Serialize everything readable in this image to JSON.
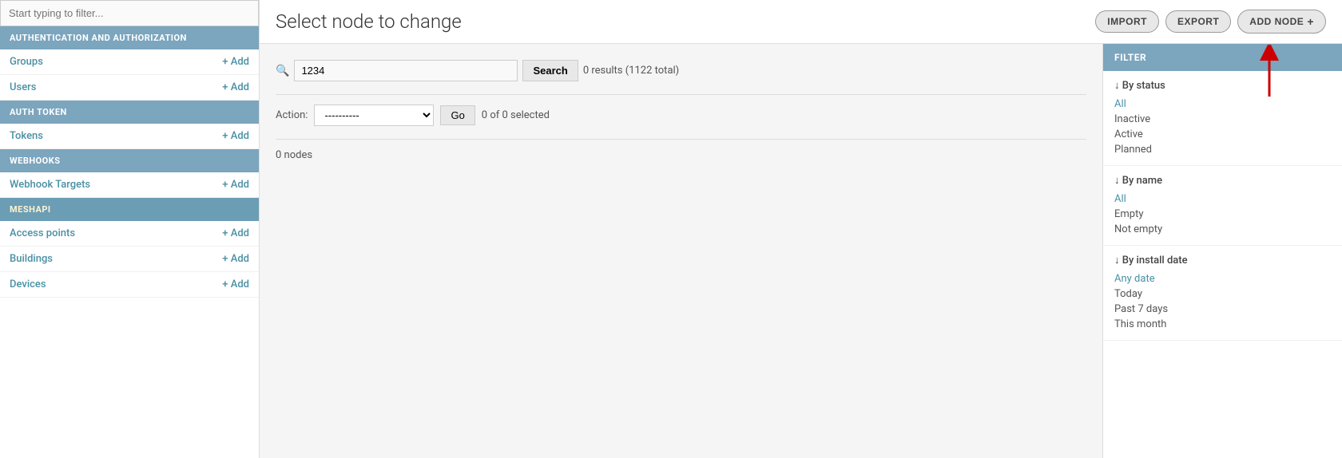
{
  "sidebar": {
    "filter_placeholder": "Start typing to filter...",
    "sections": [
      {
        "id": "auth",
        "label": "AUTHENTICATION AND AUTHORIZATION",
        "variant": "default",
        "items": [
          {
            "id": "groups",
            "label": "Groups",
            "add_label": "+ Add"
          },
          {
            "id": "users",
            "label": "Users",
            "add_label": "+ Add"
          }
        ]
      },
      {
        "id": "auth-token",
        "label": "AUTH TOKEN",
        "variant": "default",
        "items": [
          {
            "id": "tokens",
            "label": "Tokens",
            "add_label": "+ Add"
          }
        ]
      },
      {
        "id": "webhooks",
        "label": "WEBHOOKS",
        "variant": "default",
        "items": [
          {
            "id": "webhook-targets",
            "label": "Webhook Targets",
            "add_label": "+ Add"
          }
        ]
      },
      {
        "id": "meshapi",
        "label": "MESHAPI",
        "variant": "meshapi",
        "items": [
          {
            "id": "access-points",
            "label": "Access points",
            "add_label": "+ Add"
          },
          {
            "id": "buildings",
            "label": "Buildings",
            "add_label": "+ Add"
          },
          {
            "id": "devices",
            "label": "Devices",
            "add_label": "+ Add"
          }
        ]
      }
    ]
  },
  "topbar": {
    "title": "Select node to change",
    "import_label": "IMPORT",
    "export_label": "EXPORT",
    "add_node_label": "ADD NODE",
    "add_node_icon": "+"
  },
  "search": {
    "value": "1234",
    "button_label": "Search",
    "results_info": "0 results (1122 total)"
  },
  "action_bar": {
    "label": "Action:",
    "select_default": "----------",
    "go_label": "Go",
    "selected_info": "0 of 0 selected"
  },
  "nodes_count": "0 nodes",
  "filter": {
    "header_label": "FILTER",
    "sections": [
      {
        "id": "by-status",
        "title": "↓ By status",
        "items": [
          {
            "label": "All",
            "is_link": true
          },
          {
            "label": "Inactive",
            "is_link": false
          },
          {
            "label": "Active",
            "is_link": false
          },
          {
            "label": "Planned",
            "is_link": false
          }
        ]
      },
      {
        "id": "by-name",
        "title": "↓ By name",
        "items": [
          {
            "label": "All",
            "is_link": true
          },
          {
            "label": "Empty",
            "is_link": false
          },
          {
            "label": "Not empty",
            "is_link": false
          }
        ]
      },
      {
        "id": "by-install-date",
        "title": "↓ By install date",
        "items": [
          {
            "label": "Any date",
            "is_link": true
          },
          {
            "label": "Today",
            "is_link": false
          },
          {
            "label": "Past 7 days",
            "is_link": false
          },
          {
            "label": "This month",
            "is_link": false
          }
        ]
      }
    ]
  }
}
